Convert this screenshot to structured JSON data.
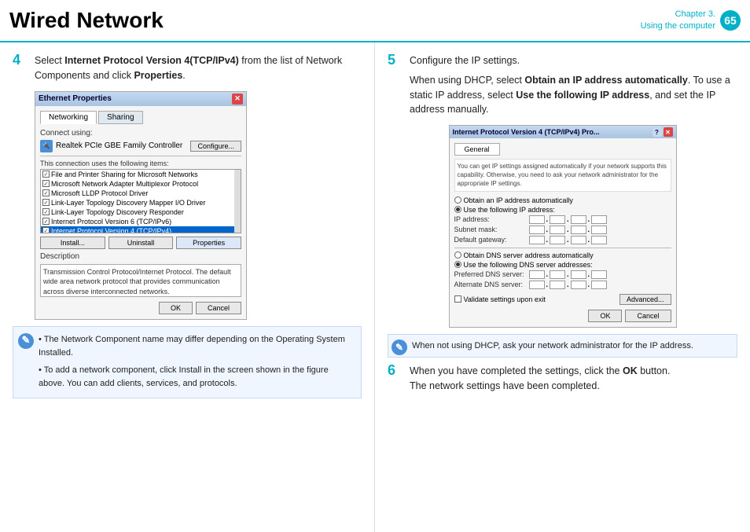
{
  "header": {
    "title": "Wired Network",
    "chapter": "Chapter 3.",
    "chapter_sub": "Using the computer",
    "page_num": "65"
  },
  "step4": {
    "num": "4",
    "text_before": "Select ",
    "bold1": "Internet Protocol Version 4(TCP/IPv4)",
    "text_middle": " from the list of Network Components and click ",
    "bold2": "Properties",
    "text_after": "."
  },
  "ethernet_dialog": {
    "title": "Ethernet Properties",
    "tab_networking": "Networking",
    "tab_sharing": "Sharing",
    "connect_using_label": "Connect using:",
    "adapter_name": "Realtek PCIe GBE Family Controller",
    "configure_btn": "Configure...",
    "items_label": "This connection uses the following items:",
    "list_items": [
      {
        "label": "File and Printer Sharing for Microsoft Networks",
        "checked": true
      },
      {
        "label": "Microsoft Network Adapter Multiplexor Protocol",
        "checked": true
      },
      {
        "label": "Microsoft LLDP Protocol Driver",
        "checked": true
      },
      {
        "label": "Link-Layer Topology Discovery Mapper I/O Driver",
        "checked": true
      },
      {
        "label": "Link-Layer Topology Discovery Responder",
        "checked": true
      },
      {
        "label": "Internet Protocol Version 6 (TCP/IPv6)",
        "checked": true
      },
      {
        "label": "Internet Protocol Version 4 (TCP/IPv4)",
        "checked": true,
        "selected": true
      }
    ],
    "install_btn": "Install...",
    "uninstall_btn": "Uninstall",
    "properties_btn": "Properties",
    "desc_label": "Description",
    "desc_text": "Transmission Control Protocol/Internet Protocol. The default wide area network protocol that provides communication across diverse interconnected networks.",
    "ok_btn": "OK",
    "cancel_btn": "Cancel"
  },
  "note4": {
    "bullets": [
      "The Network Component name may differ depending on the Operating System Installed.",
      "To add a network component, click Install in the screen shown in the figure above. You can add clients, services, and protocols."
    ]
  },
  "step5": {
    "num": "5",
    "title": "Configure the IP settings.",
    "para1_before": "When using DHCP, select ",
    "para1_bold": "Obtain an IP address automatically",
    "para1_after": ". To use a static IP address, select ",
    "para1_bold2": "Use the following IP address",
    "para1_end": ", and set the IP address manually."
  },
  "ip_dialog": {
    "title": "Internet Protocol Version 4 (TCP/IPv4) Pro...",
    "tab_general": "General",
    "info_text": "You can get IP settings assigned automatically if your network supports this capability. Otherwise, you need to ask your network administrator for the appropriate IP settings.",
    "radio1": "Obtain an IP address automatically",
    "radio2": "Use the following IP address:",
    "ip_label": "IP address:",
    "subnet_label": "Subnet mask:",
    "gateway_label": "Default gateway:",
    "dns_radio1": "Obtain DNS server address automatically",
    "dns_radio2": "Use the following DNS server addresses:",
    "preferred_dns": "Preferred DNS server:",
    "alternate_dns": "Alternate DNS server:",
    "validate_check": "Validate settings upon exit",
    "advanced_btn": "Advanced...",
    "ok_btn": "OK",
    "cancel_btn": "Cancel"
  },
  "note5": {
    "text": "When not using DHCP, ask your network administrator for the IP address."
  },
  "step6": {
    "num": "6",
    "text_before": "When you have completed the settings, click the ",
    "bold": "OK",
    "text_after": " button.",
    "line2": "The network settings have been completed."
  }
}
